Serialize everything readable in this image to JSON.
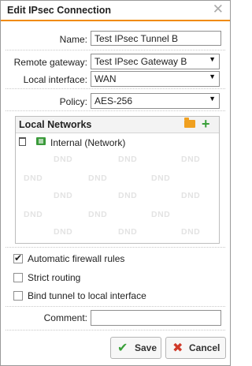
{
  "dialog": {
    "title": "Edit IPsec Connection",
    "close_glyph": "✕"
  },
  "form": {
    "name_label": "Name:",
    "name_value": "Test IPsec Tunnel B",
    "remote_gateway_label": "Remote gateway:",
    "remote_gateway_value": "Test IPsec Gateway B",
    "local_interface_label": "Local interface:",
    "local_interface_value": "WAN",
    "policy_label": "Policy:",
    "policy_value": "AES-256"
  },
  "local_networks": {
    "header": "Local Networks",
    "items": [
      {
        "name": "Internal (Network)",
        "icon": "network-icon"
      }
    ],
    "watermark": "DND"
  },
  "options": {
    "automatic_firewall_rules": {
      "label": "Automatic firewall rules",
      "checked": true
    },
    "strict_routing": {
      "label": "Strict routing",
      "checked": false
    },
    "bind_tunnel": {
      "label": "Bind tunnel to local interface",
      "checked": false
    }
  },
  "comment": {
    "label": "Comment:",
    "value": ""
  },
  "buttons": {
    "save": "Save",
    "cancel": "Cancel"
  },
  "colors": {
    "accent": "#f08a00",
    "save_green": "#3aa03a",
    "cancel_red": "#d03a2a"
  }
}
